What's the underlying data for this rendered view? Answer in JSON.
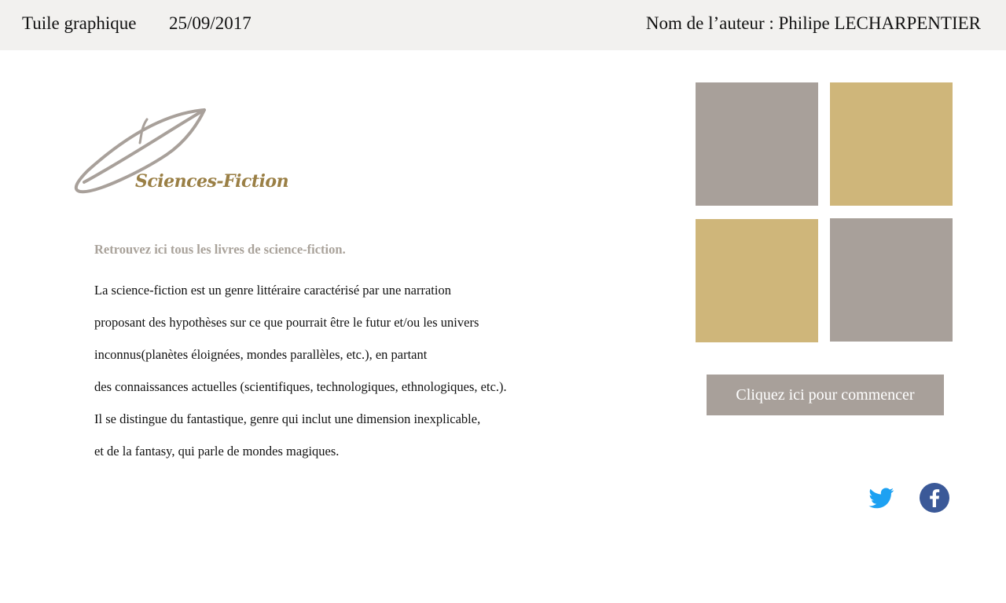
{
  "header": {
    "title": "Tuile graphique",
    "date": "25/09/2017",
    "author": "Nom de l’auteur : Philipe LECHARPENTIER"
  },
  "logo": {
    "text": "Sciences-Fiction",
    "icon": "feather-quill-icon",
    "color": "#a8a09a",
    "text_color": "#9a7f45"
  },
  "content": {
    "intro": "Retrouvez ici tous les livres de science-fiction.",
    "lines": [
      "La science-fiction est un genre littéraire caractérisé par une narration",
      "proposant des hypothèses sur ce que pourrait être le futur et/ou les univers",
      "inconnus(planètes éloignées, mondes parallèles, etc.), en partant",
      "des connaissances actuelles (scientifiques, technologiques, ethnologiques, etc.).",
      "Il se distingue du fantastique, genre qui inclut une dimension inexplicable,",
      "et de la fantasy, qui parle de mondes magiques."
    ]
  },
  "tiles": {
    "colors": {
      "gray": "#a8a09a",
      "gold": "#cfb67a"
    },
    "order": [
      "gray",
      "gold",
      "gold",
      "gray"
    ]
  },
  "start_button": {
    "label": "Cliquez ici pour commencer",
    "color": "#a8a09a"
  },
  "social": {
    "twitter": {
      "icon": "twitter-icon",
      "color": "#1da1f2"
    },
    "facebook": {
      "icon": "facebook-icon",
      "color": "#3b5998"
    }
  },
  "colors": {
    "header_bg": "#f2f1ef",
    "intro_text": "#a9a29a"
  }
}
